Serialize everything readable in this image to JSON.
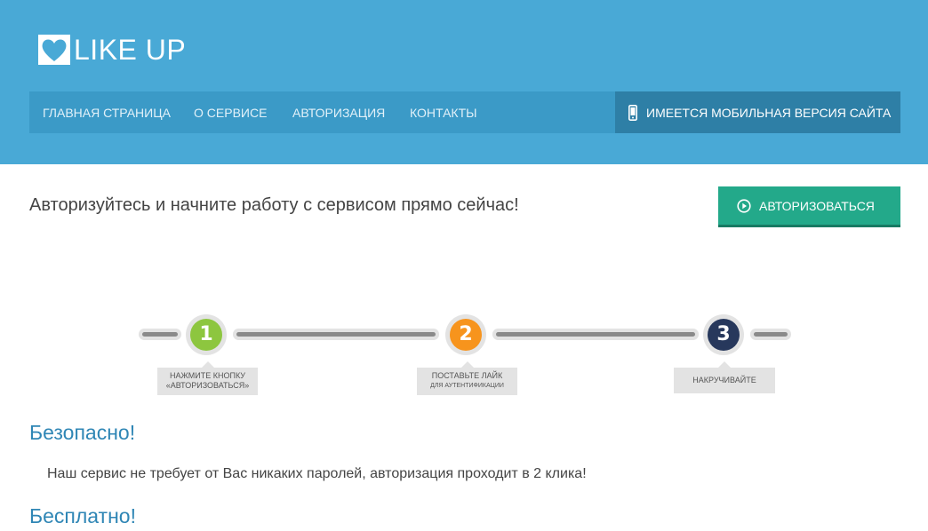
{
  "logo": {
    "text": "LIKE UP"
  },
  "nav": {
    "items": [
      {
        "label": "ГЛАВНАЯ СТРАНИЦА"
      },
      {
        "label": "О СЕРВИСЕ"
      },
      {
        "label": "АВТОРИЗАЦИЯ"
      },
      {
        "label": "КОНТАКТЫ"
      }
    ],
    "mobile_label": "ИМЕЕТСЯ МОБИЛЬНАЯ ВЕРСИЯ САЙТА"
  },
  "cta": {
    "text": "Авторизуйтесь и начните работу с сервисом прямо сейчас!",
    "button_label": "АВТОРИЗОВАТЬСЯ"
  },
  "steps": [
    {
      "number": "1",
      "color": "#8dc63f",
      "line1": "НАЖМИТЕ КНОПКУ",
      "line2": "«АВТОРИЗОВАТЬСЯ»"
    },
    {
      "number": "2",
      "color": "#f7941d",
      "line1": "ПОСТАВЬТЕ ЛАЙК",
      "line2": "ДЛЯ АУТЕНТИФИКАЦИИ"
    },
    {
      "number": "3",
      "color": "#27385c",
      "line1": "НАКРУЧИВАЙТЕ",
      "line2": ""
    }
  ],
  "sections": [
    {
      "title": "Безопасно!",
      "text": "Наш сервис не требует от Вас никаких паролей, авторизация проходит в 2 клика!"
    },
    {
      "title": "Бесплатно!"
    }
  ],
  "colors": {
    "header_bg": "#49a9d6",
    "nav_bg": "#3b9ac7",
    "mobile_bg": "#2e7fa6",
    "cta_button": "#23a98a",
    "heading": "#2f86b5"
  },
  "icons": {
    "logo": "heart-logo-icon",
    "mobile": "smartphone-icon",
    "cta": "play-circle-icon"
  }
}
